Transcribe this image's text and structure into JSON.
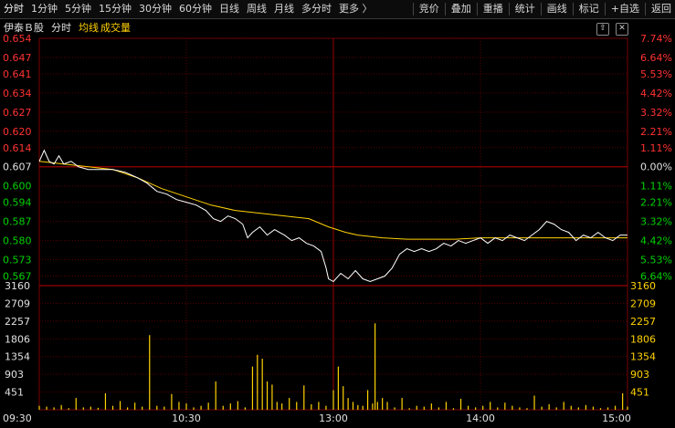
{
  "toolbar": {
    "items": [
      "分时",
      "1分钟",
      "5分钟",
      "15分钟",
      "30分钟",
      "60分钟",
      "日线",
      "周线",
      "月线",
      "多分时",
      "更多 〉"
    ],
    "right_items": [
      "竞价",
      "叠加",
      "重播",
      "统计",
      "画线",
      "标记",
      "+自选",
      "返回"
    ]
  },
  "header": {
    "name": "伊泰Ｂ股",
    "mode": "分时",
    "avg_label": "均线",
    "vol_label": "成交量"
  },
  "icons": {
    "up": "circle-up-icon",
    "close": "close-icon"
  },
  "colors": {
    "up": "#ff3232",
    "down": "#00d200",
    "flat": "#e0e0e0",
    "avg": "#ffd200",
    "price": "#ffffff",
    "grid": "#5a0000",
    "volume": "#ffd200"
  },
  "chart_data": {
    "type": "line",
    "price_ticks": [
      "0.654",
      "0.647",
      "0.641",
      "0.634",
      "0.627",
      "0.620",
      "0.614",
      "0.607",
      "0.600",
      "0.594",
      "0.587",
      "0.580",
      "0.573",
      "0.567"
    ],
    "pct_ticks": [
      "7.74%",
      "6.64%",
      "5.53%",
      "4.42%",
      "3.32%",
      "2.21%",
      "1.11%",
      "0.00%",
      "1.11%",
      "2.21%",
      "3.32%",
      "4.42%",
      "5.53%",
      "6.64%"
    ],
    "pre_close": 0.607,
    "ylim": [
      0.5635,
      0.654
    ],
    "volume_ticks": [
      "3160",
      "2709",
      "2257",
      "1806",
      "1354",
      "903",
      "451"
    ],
    "volume_ylim": [
      0,
      3160
    ],
    "x_ticks": [
      "09:30",
      "10:30",
      "13:00",
      "14:00",
      "15:00"
    ],
    "price_series": [
      [
        0,
        0.609
      ],
      [
        2,
        0.613
      ],
      [
        4,
        0.609
      ],
      [
        6,
        0.608
      ],
      [
        8,
        0.611
      ],
      [
        10,
        0.608
      ],
      [
        13,
        0.609
      ],
      [
        16,
        0.607
      ],
      [
        20,
        0.606
      ],
      [
        25,
        0.606
      ],
      [
        30,
        0.606
      ],
      [
        35,
        0.605
      ],
      [
        40,
        0.603
      ],
      [
        44,
        0.601
      ],
      [
        48,
        0.598
      ],
      [
        52,
        0.597
      ],
      [
        56,
        0.595
      ],
      [
        60,
        0.594
      ],
      [
        64,
        0.593
      ],
      [
        68,
        0.591
      ],
      [
        71,
        0.588
      ],
      [
        74,
        0.587
      ],
      [
        77,
        0.589
      ],
      [
        80,
        0.588
      ],
      [
        83,
        0.586
      ],
      [
        85,
        0.581
      ],
      [
        87,
        0.583
      ],
      [
        90,
        0.585
      ],
      [
        93,
        0.582
      ],
      [
        96,
        0.584
      ],
      [
        100,
        0.582
      ],
      [
        103,
        0.58
      ],
      [
        106,
        0.581
      ],
      [
        109,
        0.579
      ],
      [
        112,
        0.578
      ],
      [
        115,
        0.576
      ],
      [
        117,
        0.57
      ],
      [
        118,
        0.566
      ],
      [
        120,
        0.565
      ],
      [
        123,
        0.568
      ],
      [
        126,
        0.566
      ],
      [
        129,
        0.569
      ],
      [
        132,
        0.566
      ],
      [
        135,
        0.565
      ],
      [
        138,
        0.566
      ],
      [
        141,
        0.567
      ],
      [
        144,
        0.57
      ],
      [
        147,
        0.575
      ],
      [
        150,
        0.577
      ],
      [
        153,
        0.576
      ],
      [
        156,
        0.577
      ],
      [
        159,
        0.576
      ],
      [
        162,
        0.577
      ],
      [
        165,
        0.579
      ],
      [
        168,
        0.578
      ],
      [
        171,
        0.58
      ],
      [
        174,
        0.579
      ],
      [
        177,
        0.58
      ],
      [
        180,
        0.581
      ],
      [
        183,
        0.579
      ],
      [
        186,
        0.581
      ],
      [
        189,
        0.58
      ],
      [
        192,
        0.582
      ],
      [
        195,
        0.581
      ],
      [
        198,
        0.58
      ],
      [
        201,
        0.582
      ],
      [
        204,
        0.584
      ],
      [
        207,
        0.587
      ],
      [
        210,
        0.586
      ],
      [
        213,
        0.584
      ],
      [
        216,
        0.583
      ],
      [
        219,
        0.58
      ],
      [
        222,
        0.582
      ],
      [
        225,
        0.581
      ],
      [
        228,
        0.583
      ],
      [
        231,
        0.581
      ],
      [
        234,
        0.58
      ],
      [
        237,
        0.582
      ],
      [
        240,
        0.582
      ]
    ],
    "avg_series": [
      [
        0,
        0.609
      ],
      [
        10,
        0.608
      ],
      [
        20,
        0.607
      ],
      [
        30,
        0.606
      ],
      [
        40,
        0.603
      ],
      [
        50,
        0.599
      ],
      [
        60,
        0.596
      ],
      [
        70,
        0.593
      ],
      [
        80,
        0.591
      ],
      [
        90,
        0.59
      ],
      [
        100,
        0.589
      ],
      [
        110,
        0.588
      ],
      [
        118,
        0.585
      ],
      [
        125,
        0.583
      ],
      [
        130,
        0.582
      ],
      [
        140,
        0.581
      ],
      [
        150,
        0.5805
      ],
      [
        160,
        0.5805
      ],
      [
        170,
        0.5805
      ],
      [
        180,
        0.581
      ],
      [
        200,
        0.581
      ],
      [
        220,
        0.581
      ],
      [
        240,
        0.581
      ]
    ],
    "volume": [
      [
        0,
        100
      ],
      [
        3,
        80
      ],
      [
        6,
        60
      ],
      [
        9,
        120
      ],
      [
        12,
        40
      ],
      [
        15,
        300
      ],
      [
        18,
        60
      ],
      [
        21,
        80
      ],
      [
        24,
        50
      ],
      [
        27,
        420
      ],
      [
        30,
        100
      ],
      [
        33,
        220
      ],
      [
        36,
        60
      ],
      [
        39,
        180
      ],
      [
        42,
        80
      ],
      [
        45,
        1900
      ],
      [
        48,
        100
      ],
      [
        51,
        80
      ],
      [
        54,
        400
      ],
      [
        57,
        200
      ],
      [
        60,
        160
      ],
      [
        63,
        60
      ],
      [
        66,
        100
      ],
      [
        69,
        180
      ],
      [
        72,
        720
      ],
      [
        75,
        100
      ],
      [
        78,
        160
      ],
      [
        81,
        220
      ],
      [
        84,
        60
      ],
      [
        87,
        1100
      ],
      [
        89,
        1400
      ],
      [
        91,
        1300
      ],
      [
        93,
        720
      ],
      [
        95,
        640
      ],
      [
        97,
        200
      ],
      [
        99,
        160
      ],
      [
        102,
        300
      ],
      [
        105,
        200
      ],
      [
        108,
        620
      ],
      [
        111,
        140
      ],
      [
        114,
        200
      ],
      [
        117,
        100
      ],
      [
        120,
        500
      ],
      [
        122,
        1100
      ],
      [
        124,
        600
      ],
      [
        126,
        300
      ],
      [
        128,
        200
      ],
      [
        130,
        120
      ],
      [
        132,
        100
      ],
      [
        134,
        500
      ],
      [
        136,
        160
      ],
      [
        138,
        200
      ],
      [
        140,
        300
      ],
      [
        142,
        200
      ],
      [
        145,
        60
      ],
      [
        148,
        300
      ],
      [
        151,
        40
      ],
      [
        154,
        100
      ],
      [
        157,
        80
      ],
      [
        160,
        160
      ],
      [
        163,
        60
      ],
      [
        166,
        200
      ],
      [
        169,
        40
      ],
      [
        172,
        280
      ],
      [
        175,
        100
      ],
      [
        178,
        60
      ],
      [
        181,
        100
      ],
      [
        184,
        200
      ],
      [
        187,
        60
      ],
      [
        190,
        180
      ],
      [
        193,
        100
      ],
      [
        196,
        60
      ],
      [
        199,
        40
      ],
      [
        202,
        360
      ],
      [
        205,
        80
      ],
      [
        208,
        140
      ],
      [
        211,
        60
      ],
      [
        214,
        200
      ],
      [
        217,
        100
      ],
      [
        220,
        60
      ],
      [
        223,
        120
      ],
      [
        226,
        80
      ],
      [
        229,
        40
      ],
      [
        232,
        60
      ],
      [
        235,
        100
      ],
      [
        238,
        420
      ],
      [
        240,
        80
      ]
    ],
    "volume_spikes": [
      [
        137,
        2200
      ]
    ],
    "grid": true
  }
}
